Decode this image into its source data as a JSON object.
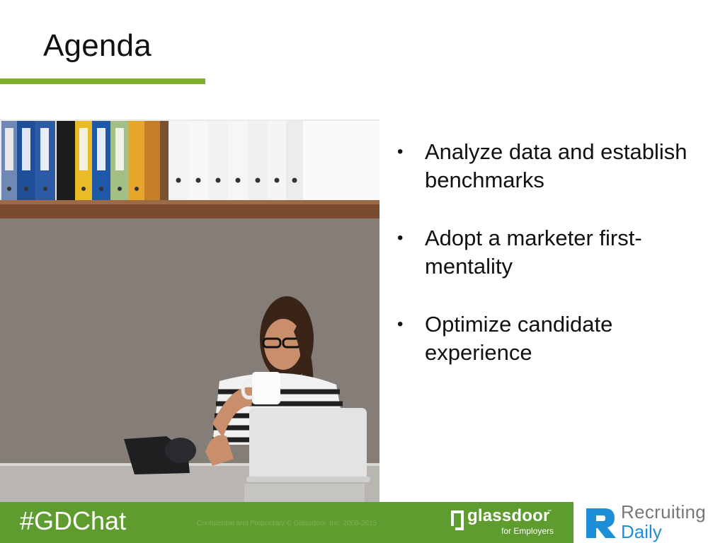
{
  "slide": {
    "title": "Agenda",
    "accent_color": "#7cb02e",
    "bullets": [
      "Analyze data and establish benchmarks",
      "Adopt a marketer first-mentality",
      "Optimize candidate experience"
    ],
    "bullet_glyph": "•"
  },
  "photo": {
    "description_icon": "office-woman-photo"
  },
  "footer": {
    "hashtag": "#GDChat",
    "confidential": "Confidential and Proprietary © Glassdoor, Inc. 2008-2015",
    "background_color": "#5f9c2f",
    "glassdoor": {
      "name": "glassdoor",
      "mark": "℠",
      "subtitle": "for Employers"
    },
    "recruiting_daily": {
      "line1": "Recruiting",
      "line2": "Daily",
      "brand_color": "#1d8fd8"
    }
  }
}
